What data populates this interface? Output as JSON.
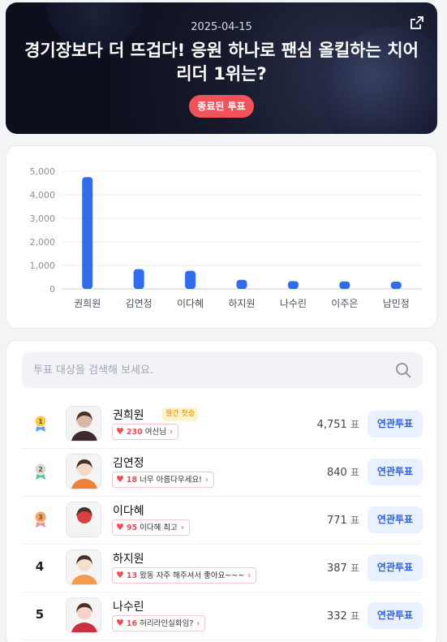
{
  "hero": {
    "date": "2025-04-15",
    "title": "경기장보다 더 뜨겁다! 응원 하나로 팬심 올킬하는 치어리더 1위는?",
    "status_badge": "종료된 투표",
    "share_icon": "share-external-icon"
  },
  "chart_data": {
    "type": "bar",
    "categories": [
      "권희원",
      "김연정",
      "이다혜",
      "하지원",
      "나수린",
      "이주은",
      "남민정"
    ],
    "values": [
      4751,
      840,
      771,
      387,
      332,
      320,
      310
    ],
    "ylim": [
      0,
      5000
    ],
    "yticks": [
      "0",
      "1,000",
      "2,000",
      "3,000",
      "4,000",
      "5,000"
    ],
    "grid": true,
    "bar_color": "#2f6df0"
  },
  "search": {
    "placeholder": "투표 대상을 검색해 보세요.",
    "icon": "search-icon"
  },
  "ranking": [
    {
      "rank": "1",
      "medal": "gold",
      "name": "권희원",
      "tag": "월간 첫승",
      "cheer_count": "230",
      "cheer_text": "여신님",
      "votes": "4,751",
      "unit": "표",
      "button": "연관투표"
    },
    {
      "rank": "2",
      "medal": "silver",
      "name": "김연정",
      "tag": "",
      "cheer_count": "18",
      "cheer_text": "너무 아름다우세요!",
      "votes": "840",
      "unit": "표",
      "button": "연관투표"
    },
    {
      "rank": "3",
      "medal": "bronze",
      "name": "이다혜",
      "tag": "",
      "cheer_count": "95",
      "cheer_text": "이다혜 최고",
      "votes": "771",
      "unit": "표",
      "button": "연관투표"
    },
    {
      "rank": "4",
      "medal": "",
      "name": "하지원",
      "tag": "",
      "cheer_count": "13",
      "cheer_text": "왔동 자주 해주셔서 좋아요~~~",
      "votes": "387",
      "unit": "표",
      "button": "연관투표"
    },
    {
      "rank": "5",
      "medal": "",
      "name": "나수린",
      "tag": "",
      "cheer_count": "16",
      "cheer_text": "허리라인실화임?",
      "votes": "332",
      "unit": "표",
      "button": "연관투표"
    }
  ],
  "colors": {
    "accent": "#2f6df0",
    "badge": "#f0535a",
    "heart": "#ef4b55"
  }
}
